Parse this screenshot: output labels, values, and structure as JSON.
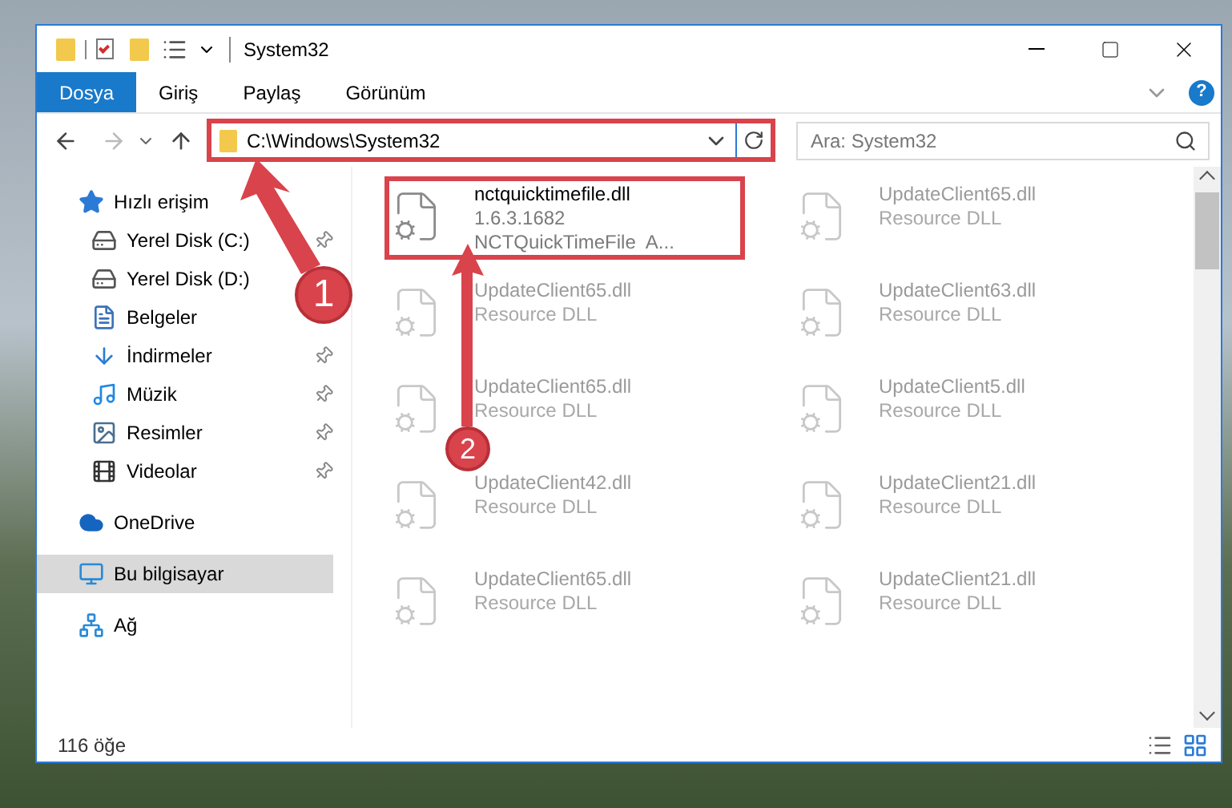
{
  "window": {
    "title": "System32"
  },
  "ribbon": {
    "tabs": [
      {
        "label": "Dosya",
        "selected": true
      },
      {
        "label": "Giriş",
        "selected": false
      },
      {
        "label": "Paylaş",
        "selected": false
      },
      {
        "label": "Görünüm",
        "selected": false
      }
    ],
    "help": "?"
  },
  "address": {
    "path": "C:\\Windows\\System32",
    "highlighted": true
  },
  "search": {
    "placeholder": "Ara: System32"
  },
  "sidebar": {
    "items": [
      {
        "label": "Hızlı erişim",
        "selected": false,
        "children": [
          {
            "label": "Yerel Disk (C:)",
            "pinned": true,
            "selected": false
          },
          {
            "label": "Yerel Disk (D:)",
            "pinned": false,
            "selected": false
          },
          {
            "label": "Belgeler",
            "pinned": false,
            "selected": false
          },
          {
            "label": "İndirmeler",
            "pinned": true,
            "selected": false
          },
          {
            "label": "Müzik",
            "pinned": true,
            "selected": false
          },
          {
            "label": "Resimler",
            "pinned": true,
            "selected": false
          },
          {
            "label": "Videolar",
            "pinned": true,
            "selected": false
          }
        ]
      },
      {
        "label": "OneDrive",
        "selected": false
      },
      {
        "label": "Bu bilgisayar",
        "selected": true
      },
      {
        "label": "Ağ",
        "selected": false
      }
    ]
  },
  "files": [
    {
      "name": "nctquicktimefile.dll",
      "details": [
        "1.6.3.1682",
        "NCTQuickTimeFile  A..."
      ],
      "faded": false,
      "highlighted": true
    },
    {
      "name": "UpdateClient65.dll",
      "details": [
        "Resource DLL"
      ],
      "faded": true,
      "highlighted": false
    },
    {
      "name": "UpdateClient65.dll",
      "details": [
        "Resource DLL"
      ],
      "faded": true,
      "highlighted": false
    },
    {
      "name": "UpdateClient63.dll",
      "details": [
        "Resource DLL"
      ],
      "faded": true,
      "highlighted": false
    },
    {
      "name": "UpdateClient65.dll",
      "details": [
        "Resource DLL"
      ],
      "faded": true,
      "highlighted": false
    },
    {
      "name": "UpdateClient5.dll",
      "details": [
        "Resource DLL"
      ],
      "faded": true,
      "highlighted": false
    },
    {
      "name": "UpdateClient42.dll",
      "details": [
        "Resource DLL"
      ],
      "faded": true,
      "highlighted": false
    },
    {
      "name": "UpdateClient21.dll",
      "details": [
        "Resource DLL"
      ],
      "faded": true,
      "highlighted": false
    },
    {
      "name": "UpdateClient65.dll",
      "details": [
        "Resource DLL"
      ],
      "faded": true,
      "highlighted": false
    },
    {
      "name": "UpdateClient21.dll",
      "details": [
        "Resource DLL"
      ],
      "faded": true,
      "highlighted": false
    }
  ],
  "annotations": [
    {
      "number": "1"
    },
    {
      "number": "2"
    }
  ],
  "status_bar": {
    "count": "116 öğe"
  }
}
